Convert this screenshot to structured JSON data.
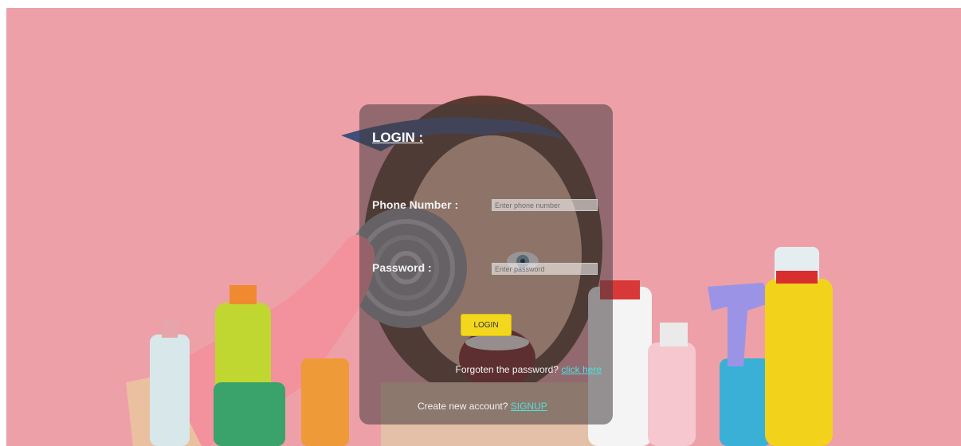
{
  "colors": {
    "background": "#eda0a8",
    "card": "rgba(70,60,62,0.55)",
    "button": "#f2d71e",
    "link": "#4ee0e0"
  },
  "login": {
    "title": "LOGIN :",
    "phone_label": "Phone Number :",
    "phone_placeholder": "Enter phone number",
    "password_label": "Password :",
    "password_placeholder": "Enter password",
    "button_label": "LOGIN",
    "forgot_text": "Forgoten the password?",
    "forgot_link": "click here",
    "create_text": "Create new account?",
    "signup_link": "SIGNUP"
  }
}
